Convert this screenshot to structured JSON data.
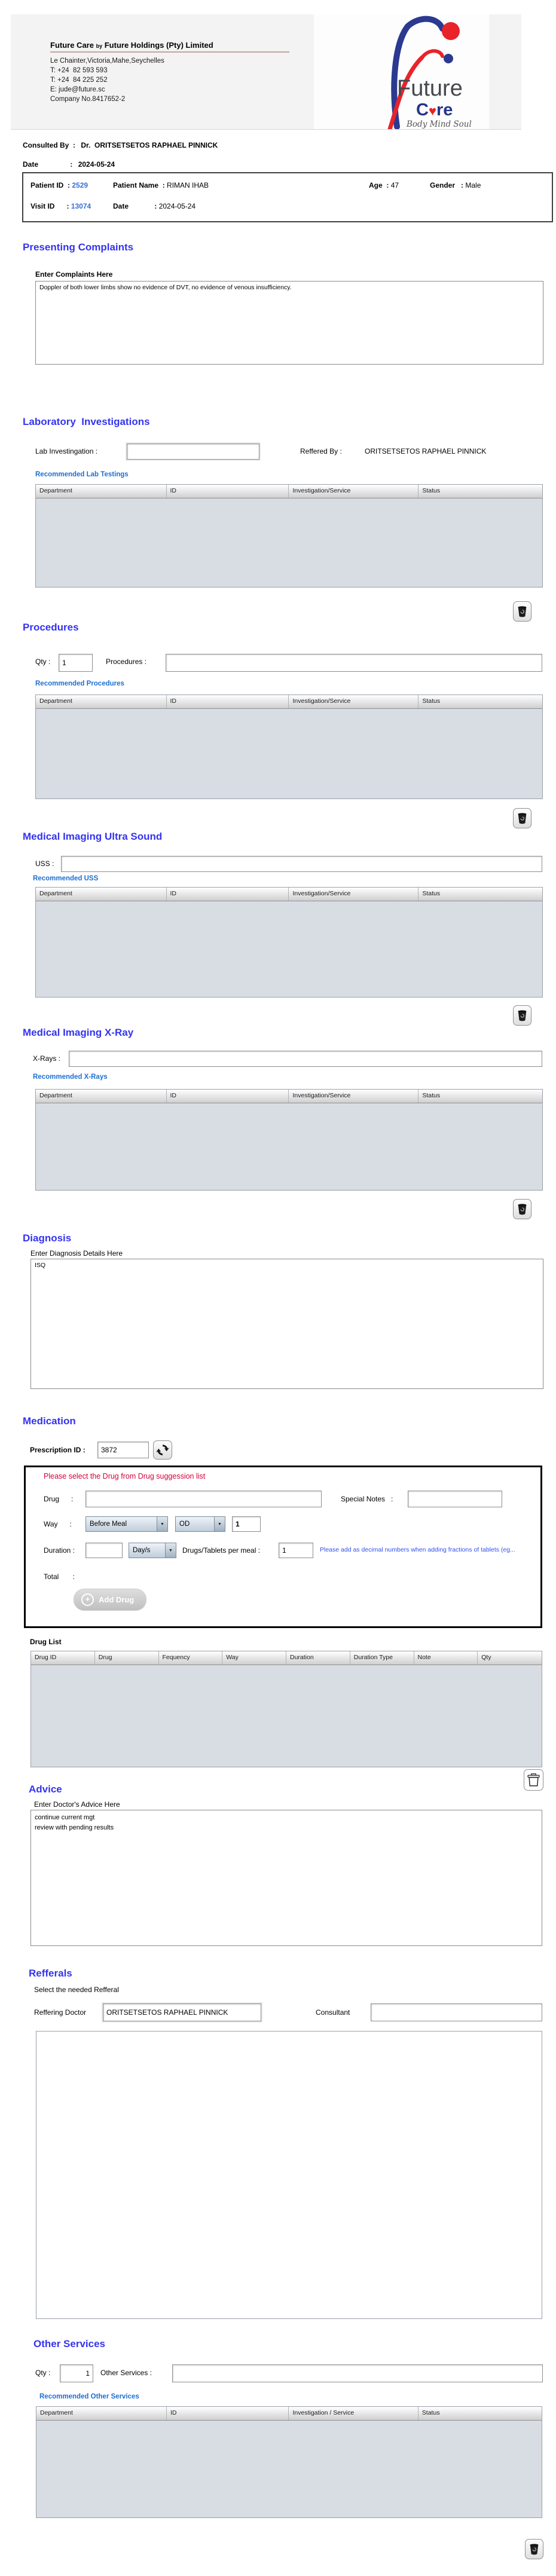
{
  "letterhead": {
    "title_1": "Future Care",
    "title_by": "by",
    "title_2": "Future Holdings (Pty) Limited",
    "address": "Le Chainter,Victoria,Mahe,Seychelles",
    "phone1": "T: +24  82 593 593",
    "phone2": "T: +24  84 225 252",
    "email": "E: jude@future.sc",
    "company_no": "Company No.8417652-2"
  },
  "logo": {
    "name_top": "Future",
    "care_c": "C",
    "care_heart": "♥",
    "care_re": "re",
    "tagline": "Body Mind Soul"
  },
  "consulted": {
    "label": "Consulted By  :",
    "value": "Dr.  ORITSETSETOS RAPHAEL PINNICK",
    "date_label": "Date                :",
    "date_value": "2024-05-24"
  },
  "patient": {
    "id_label": "Patient ID  :",
    "id": "2529",
    "name_label": "Patient Name  :",
    "name": "RIMAN IHAB",
    "age_label": "Age  :",
    "age": "47",
    "gender_label": "Gender   :",
    "gender": "Male",
    "visit_label": "Visit ID      :",
    "visit_id": "13074",
    "date_label": "Date             :",
    "date": "2024-05-24"
  },
  "complaints": {
    "title": "Presenting Complaints",
    "label": "Enter Complaints Here",
    "text": "Doppler of both lower limbs show no evidence of DVT, no evidence of venous insufficiency."
  },
  "laboratory": {
    "title": "Laboratory  Investigations",
    "input_label": "Lab Investingation :",
    "input_value": "",
    "reffered_label": "Reffered By :",
    "reffered_value": "ORITSETSETOS RAPHAEL PINNICK",
    "link": "Recommended Lab Testings",
    "headers": [
      "Department",
      "ID",
      "Investigation/Service",
      "Status"
    ]
  },
  "procedures": {
    "title": "Procedures",
    "qty_label": "Qty :",
    "qty_value": "1",
    "input_label": "Procedures :",
    "input_value": "",
    "link": "Recommended Procedures",
    "headers": [
      "Department",
      "ID",
      "Investigation/Service",
      "Status"
    ]
  },
  "ultrasound": {
    "title": "Medical Imaging Ultra Sound",
    "input_label": "USS :",
    "input_value": "",
    "link": "Recommended USS",
    "headers": [
      "Department",
      "ID",
      "Investigation/Service",
      "Status"
    ]
  },
  "xray": {
    "title": "Medical Imaging X-Ray",
    "input_label": "X-Rays :",
    "input_value": "",
    "link": "Recommended X-Rays",
    "headers": [
      "Department",
      "ID",
      "Investigation/Service",
      "Status"
    ]
  },
  "diagnosis": {
    "title": "Diagnosis",
    "label": "Enter Diagnosis Details Here",
    "text": "ISQ"
  },
  "medication": {
    "title": "Medication",
    "prescription_label": "Prescription ID :",
    "prescription_value": "3872",
    "instruction": "Please select the Drug from Drug suggession list",
    "drug_label": "Drug      :",
    "drug_value": "",
    "special_label": "Special Notes   :",
    "special_value": "",
    "way_label": "Way      :",
    "way_value": "Before Meal",
    "freq_value": "OD",
    "way_qty": "1",
    "duration_label": "Duration :",
    "duration_value": "",
    "duration_type": "Day/s",
    "per_meal_label": "Drugs/Tablets per meal :",
    "per_meal_value": "1",
    "note": "Please add as decimal numbers when adding fractions of tablets (eg...",
    "total_label": "Total       :",
    "add_drug": "Add Drug",
    "drug_list_label": "Drug List",
    "drug_headers": [
      "Drug ID",
      "Drug",
      "Fequency",
      "Way",
      "Duration",
      "Duration Type",
      "Note",
      "Qty"
    ]
  },
  "advice": {
    "title": "Advice",
    "label": "Enter Doctor's Advice Here",
    "text": "continue current mgt\nreview with pending results"
  },
  "refferals": {
    "title": "Refferals",
    "label": "Select the needed Refferal",
    "doctor_label": "Reffering Doctor",
    "doctor_value": "ORITSETSETOS RAPHAEL PINNICK",
    "consultant_label": "Consultant",
    "consultant_value": ""
  },
  "other_services": {
    "title": "Other Services",
    "qty_label": "Qty :",
    "qty_value": "1",
    "input_label": "Other Services :",
    "input_value": "",
    "link": "Recommended Other Services",
    "headers": [
      "Department",
      "ID",
      "Investigation / Service",
      "Status"
    ]
  }
}
